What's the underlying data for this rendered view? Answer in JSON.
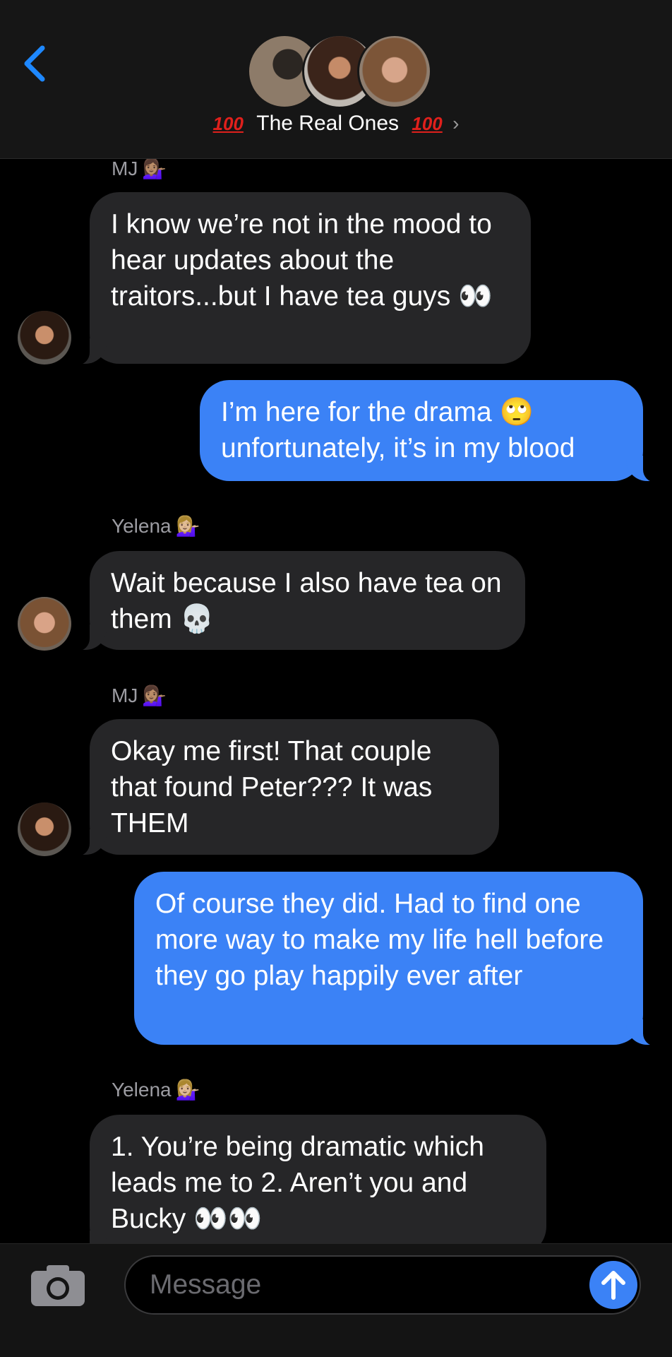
{
  "header": {
    "group_name": "The Real Ones",
    "hundred_left": "100",
    "hundred_right": "100",
    "chevron": "›"
  },
  "messages": [
    {
      "type": "sender",
      "name": "MJ",
      "emoji": "💁🏽‍♀️"
    },
    {
      "type": "received",
      "text": "I know we’re not in the mood to hear updates about the traitors...but I have tea guys 👀"
    },
    {
      "type": "sent",
      "text": "I’m here for the drama 🙄 unfortunately, it’s in my blood"
    },
    {
      "type": "sender",
      "name": "Yelena",
      "emoji": "💁🏼‍♀️"
    },
    {
      "type": "received",
      "text": "Wait because I also have tea on them 💀"
    },
    {
      "type": "sender",
      "name": "MJ",
      "emoji": "💁🏽‍♀️"
    },
    {
      "type": "received",
      "text": "Okay me first! That couple that found Peter??? It was THEM"
    },
    {
      "type": "sent",
      "text": "Of course they did. Had to find one more way to make my life hell before they go play happily ever after"
    },
    {
      "type": "sender",
      "name": "Yelena",
      "emoji": "💁🏼‍♀️"
    },
    {
      "type": "received",
      "text": "1. You’re being dramatic which leads me to 2. Aren’t you and Bucky 👀👀"
    }
  ],
  "composer": {
    "placeholder": "Message"
  },
  "colors": {
    "sent_bubble": "#3b82f6",
    "received_bubble": "#262628",
    "accent": "#1e88ff"
  }
}
